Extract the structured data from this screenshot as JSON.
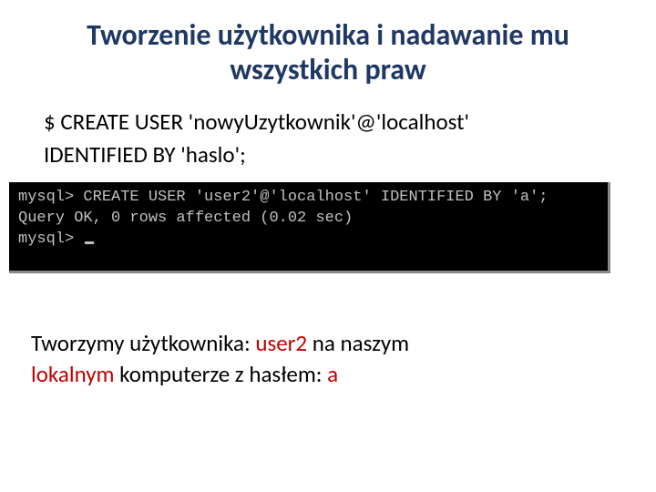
{
  "title": "Tworzenie użytkownika i nadawanie mu wszystkich praw",
  "sql": {
    "line1": "$ CREATE USER 'nowyUzytkownik'@'localhost'",
    "line2": "IDENTIFIED BY 'haslo';"
  },
  "terminal": {
    "line1": "mysql> CREATE USER 'user2'@'localhost' IDENTIFIED BY 'a';",
    "line2": "Query OK, 0 rows affected (0.02 sec)",
    "line3": "",
    "line4_prompt": "mysql> "
  },
  "desc": {
    "part1": "Tworzymy użytkownika: ",
    "user": "user2",
    "part2": " na naszym ",
    "local": "lokalnym",
    "part3": " komputerze z hasłem: ",
    "pass": "a"
  }
}
